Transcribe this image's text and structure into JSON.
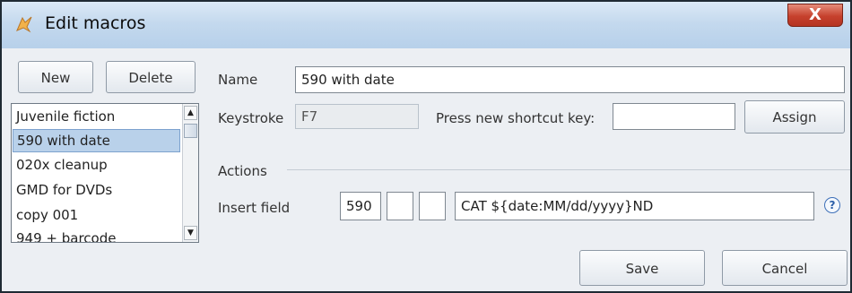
{
  "window": {
    "title": "Edit macros",
    "close_label": "X"
  },
  "macro_list": {
    "new_label": "New",
    "delete_label": "Delete",
    "items": [
      {
        "label": "Juvenile fiction",
        "selected": false
      },
      {
        "label": "590 with date",
        "selected": true
      },
      {
        "label": "020x cleanup",
        "selected": false
      },
      {
        "label": "GMD for DVDs",
        "selected": false
      },
      {
        "label": "copy 001",
        "selected": false
      },
      {
        "label": "949 + barcode",
        "selected": false
      }
    ]
  },
  "form": {
    "name_label": "Name",
    "name_value": "590 with date",
    "keystroke_label": "Keystroke",
    "keystroke_value": "F7",
    "shortcut_label": "Press new shortcut key:",
    "shortcut_value": "",
    "assign_label": "Assign"
  },
  "actions": {
    "section_label": "Actions",
    "insert_field_label": "Insert field",
    "tag_value": "590",
    "ind1_value": "",
    "ind2_value": "",
    "content_value": "CAT ${date:MM/dd/yyyy}ND",
    "help_glyph": "?"
  },
  "footer": {
    "save_label": "Save",
    "cancel_label": "Cancel"
  }
}
